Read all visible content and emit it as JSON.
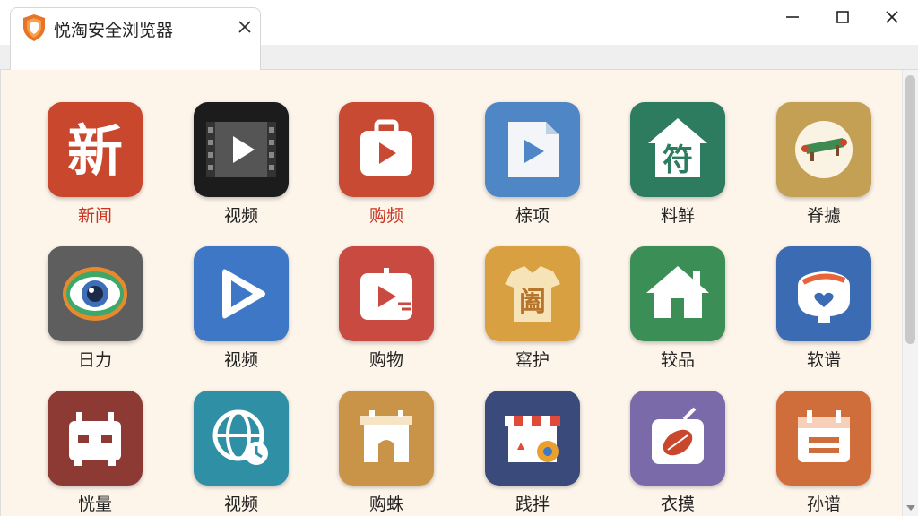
{
  "tab": {
    "title": "悦淘安全浏览器"
  },
  "colors": {
    "label_active": "#c8341f",
    "content_bg": "#fdf5ea"
  },
  "apps": [
    {
      "label": "新闻",
      "icon": "news-char-icon",
      "bg": "#c9472c"
    },
    {
      "label": "视频",
      "icon": "film-play-icon",
      "bg": "#1c1c1c"
    },
    {
      "label": "购频",
      "icon": "bag-play-icon",
      "bg": "#c94a32"
    },
    {
      "label": "榇项",
      "icon": "document-play-icon",
      "bg": "#4f86c6"
    },
    {
      "label": "料鲜",
      "icon": "house-char-icon",
      "bg": "#2d7c5f"
    },
    {
      "label": "脊攄",
      "icon": "food-plate-icon",
      "bg": "#c4a055"
    },
    {
      "label": "日力",
      "icon": "eye-icon",
      "bg": "#5e5e5e"
    },
    {
      "label": "视频",
      "icon": "play-triangle-icon",
      "bg": "#3d77c6"
    },
    {
      "label": "购物",
      "icon": "gift-play-icon",
      "bg": "#c94a40"
    },
    {
      "label": "窰护",
      "icon": "shirt-char-icon",
      "bg": "#d8a040"
    },
    {
      "label": "较品",
      "icon": "house-icon",
      "bg": "#3b8e55"
    },
    {
      "label": "软谱",
      "icon": "bowl-heart-icon",
      "bg": "#3b6bb2"
    },
    {
      "label": "恍量",
      "icon": "calendar-box-icon",
      "bg": "#8e3a34"
    },
    {
      "label": "视频",
      "icon": "globe-clock-icon",
      "bg": "#2f8fa5"
    },
    {
      "label": "购蛛",
      "icon": "store-arch-icon",
      "bg": "#c99448"
    },
    {
      "label": "践拌",
      "icon": "shop-gear-icon",
      "bg": "#3a4a7a"
    },
    {
      "label": "衣摸",
      "icon": "bag-leaf-icon",
      "bg": "#7a6aaa"
    },
    {
      "label": "孙谱",
      "icon": "calendar-icon",
      "bg": "#cf6e3a"
    }
  ]
}
